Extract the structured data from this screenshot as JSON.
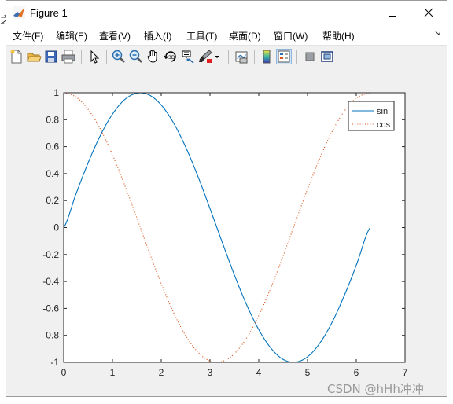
{
  "window": {
    "title": "Figure 1"
  },
  "menu": [
    {
      "label": "文件(F)"
    },
    {
      "label": "编辑(E)"
    },
    {
      "label": "查看(V)"
    },
    {
      "label": "插入(I)"
    },
    {
      "label": "工具(T)"
    },
    {
      "label": "桌面(D)"
    },
    {
      "label": "窗口(W)"
    },
    {
      "label": "帮助(H)"
    }
  ],
  "toolbar": {
    "icons": [
      "new-figure-icon",
      "open-file-icon",
      "save-icon",
      "print-icon",
      "select-arrow-icon",
      "zoom-in-icon",
      "zoom-out-icon",
      "pan-hand-icon",
      "rotate-3d-icon",
      "data-cursor-icon",
      "brush-icon",
      "link-plot-icon",
      "colorbar-icon",
      "legend-icon",
      "hide-plot-tools-icon",
      "show-plot-tools-icon"
    ]
  },
  "colors": {
    "sin": "#0072bd",
    "cos": "#d95319",
    "axes_bg": "#ffffff",
    "figure_bg": "#f0f0f0"
  },
  "chart_data": {
    "type": "line",
    "title": "",
    "xlabel": "",
    "ylabel": "",
    "xlim": [
      0,
      7
    ],
    "ylim": [
      -1,
      1
    ],
    "xticks": [
      0,
      1,
      2,
      3,
      4,
      5,
      6,
      7
    ],
    "yticks": [
      1,
      0.8,
      0.6,
      0.4,
      0.2,
      0,
      -0.2,
      -0.4,
      -0.6,
      -0.8,
      -1
    ],
    "ytick_labels": [
      "1",
      "0.8",
      "0.6",
      "0.4",
      "0.2",
      "0",
      "-0.2",
      "-0.4",
      "-0.6",
      "-0.8",
      "-1"
    ],
    "grid": false,
    "legend": "top-right",
    "x": [
      0,
      0.25,
      0.5,
      0.75,
      1.0,
      1.25,
      1.5,
      1.75,
      2.0,
      2.25,
      2.5,
      2.75,
      3.0,
      3.25,
      3.5,
      3.75,
      4.0,
      4.25,
      4.5,
      4.75,
      5.0,
      5.25,
      5.5,
      5.75,
      6.0,
      6.28
    ],
    "series": [
      {
        "name": "sin",
        "style": "solid",
        "values": [
          0,
          0.247,
          0.479,
          0.682,
          0.841,
          0.949,
          0.997,
          0.984,
          0.909,
          0.778,
          0.598,
          0.382,
          0.141,
          -0.108,
          -0.351,
          -0.572,
          -0.757,
          -0.895,
          -0.978,
          -0.999,
          -0.959,
          -0.859,
          -0.706,
          -0.508,
          -0.279,
          -0.003
        ]
      },
      {
        "name": "cos",
        "style": "dotted",
        "values": [
          1,
          0.969,
          0.878,
          0.732,
          0.54,
          0.315,
          0.071,
          -0.178,
          -0.416,
          -0.628,
          -0.801,
          -0.924,
          -0.99,
          -0.994,
          -0.936,
          -0.82,
          -0.654,
          -0.446,
          -0.211,
          0.038,
          0.284,
          0.512,
          0.709,
          0.861,
          0.96,
          1.0
        ]
      }
    ]
  },
  "watermark": "CSDN @hHh冲冲"
}
